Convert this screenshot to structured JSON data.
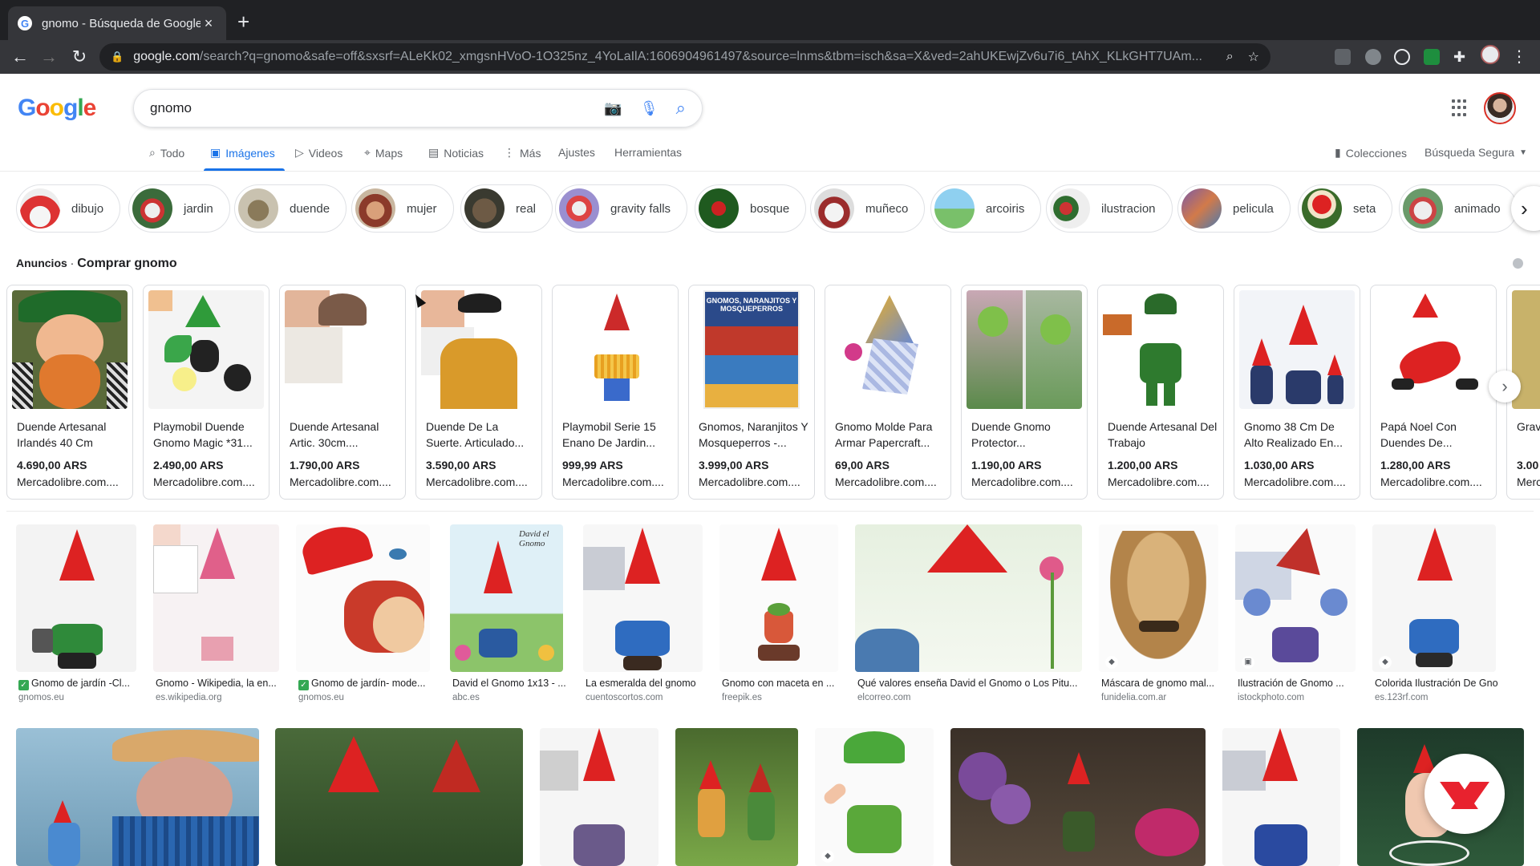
{
  "browser": {
    "tab_title": "gnomo - Búsqueda de Google",
    "url_host": "google.com",
    "url_rest": "/search?q=gnomo&safe=off&sxsrf=ALeKk02_xmgsnHVoO-1O325nz_4YoLaIlA:1606904961497&source=lnms&tbm=isch&sa=X&ved=2ahUKEwjZv6u7i6_tAhX_KLkGHT7UAm..."
  },
  "search": {
    "query": "gnomo"
  },
  "nav_tabs": [
    "Todo",
    "Imágenes",
    "Videos",
    "Maps",
    "Noticias",
    "Más",
    "Ajustes",
    "Herramientas"
  ],
  "right_links": {
    "collections": "Colecciones",
    "safe_search": "Búsqueda Segura"
  },
  "chips": [
    "dibujo",
    "jardin",
    "duende",
    "mujer",
    "real",
    "gravity falls",
    "bosque",
    "muñeco",
    "arcoiris",
    "ilustracion",
    "pelicula",
    "seta",
    "animado"
  ],
  "ads": {
    "tag": "Anuncios",
    "title": "Comprar gnomo",
    "items": [
      {
        "name": "Duende Artesanal Irlandés 40 Cm",
        "price": "4.690,00 ARS",
        "store": "Mercadolibre.com...."
      },
      {
        "name": "Playmobil Duende Gnomo Magic *31...",
        "price": "2.490,00 ARS",
        "store": "Mercadolibre.com...."
      },
      {
        "name": "Duende Artesanal Artic. 30cm....",
        "price": "1.790,00 ARS",
        "store": "Mercadolibre.com...."
      },
      {
        "name": "Duende De La Suerte. Articulado...",
        "price": "3.590,00 ARS",
        "store": "Mercadolibre.com...."
      },
      {
        "name": "Playmobil Serie 15 Enano De Jardin...",
        "price": "999,99 ARS",
        "store": "Mercadolibre.com...."
      },
      {
        "name": "Gnomos, Naranjitos Y Mosqueperros -...",
        "price": "3.999,00 ARS",
        "store": "Mercadolibre.com...."
      },
      {
        "name": "Gnomo Molde Para Armar Papercraft...",
        "price": "69,00 ARS",
        "store": "Mercadolibre.com...."
      },
      {
        "name": "Duende Gnomo Protector...",
        "price": "1.190,00 ARS",
        "store": "Mercadolibre.com...."
      },
      {
        "name": "Duende Artesanal Del Trabajo",
        "price": "1.200,00 ARS",
        "store": "Mercadolibre.com...."
      },
      {
        "name": "Gnomo 38 Cm De Alto Realizado En...",
        "price": "1.030,00 ARS",
        "store": "Mercadolibre.com...."
      },
      {
        "name": "Papá Noel Con Duendes De...",
        "price": "1.280,00 ARS",
        "store": "Mercadolibre.com...."
      },
      {
        "name": "Grav Dipp",
        "price": "3.00",
        "store": "Merc"
      }
    ],
    "book_cover_text": "GNOMOS, NARANJITOS Y MOSQUEPERROS"
  },
  "results_row1": [
    {
      "title": "Gnomo de jardín -Cl...",
      "source": "gnomos.eu",
      "verified": true
    },
    {
      "title": "Gnomo - Wikipedia, la en...",
      "source": "es.wikipedia.org",
      "verified": false
    },
    {
      "title": "Gnomo de jardín- mode...",
      "source": "gnomos.eu",
      "verified": true
    },
    {
      "title": "David el Gnomo 1x13 - ...",
      "source": "abc.es",
      "verified": false
    },
    {
      "title": "La esmeralda del gnomo",
      "source": "cuentoscortos.com",
      "verified": false
    },
    {
      "title": "Gnomo con maceta en ...",
      "source": "freepik.es",
      "verified": false
    },
    {
      "title": "Qué valores enseña David el Gnomo o Los Pitu...",
      "source": "elcorreo.com",
      "verified": false
    },
    {
      "title": "Máscara de gnomo mal...",
      "source": "funidelia.com.ar",
      "verified": false
    },
    {
      "title": "Ilustración de Gnomo ...",
      "source": "istockphoto.com",
      "verified": false
    },
    {
      "title": "Colorida Ilustración De Gnom...",
      "source": "es.123rf.com",
      "verified": false
    }
  ],
  "book_title_text": "David el Gnomo"
}
